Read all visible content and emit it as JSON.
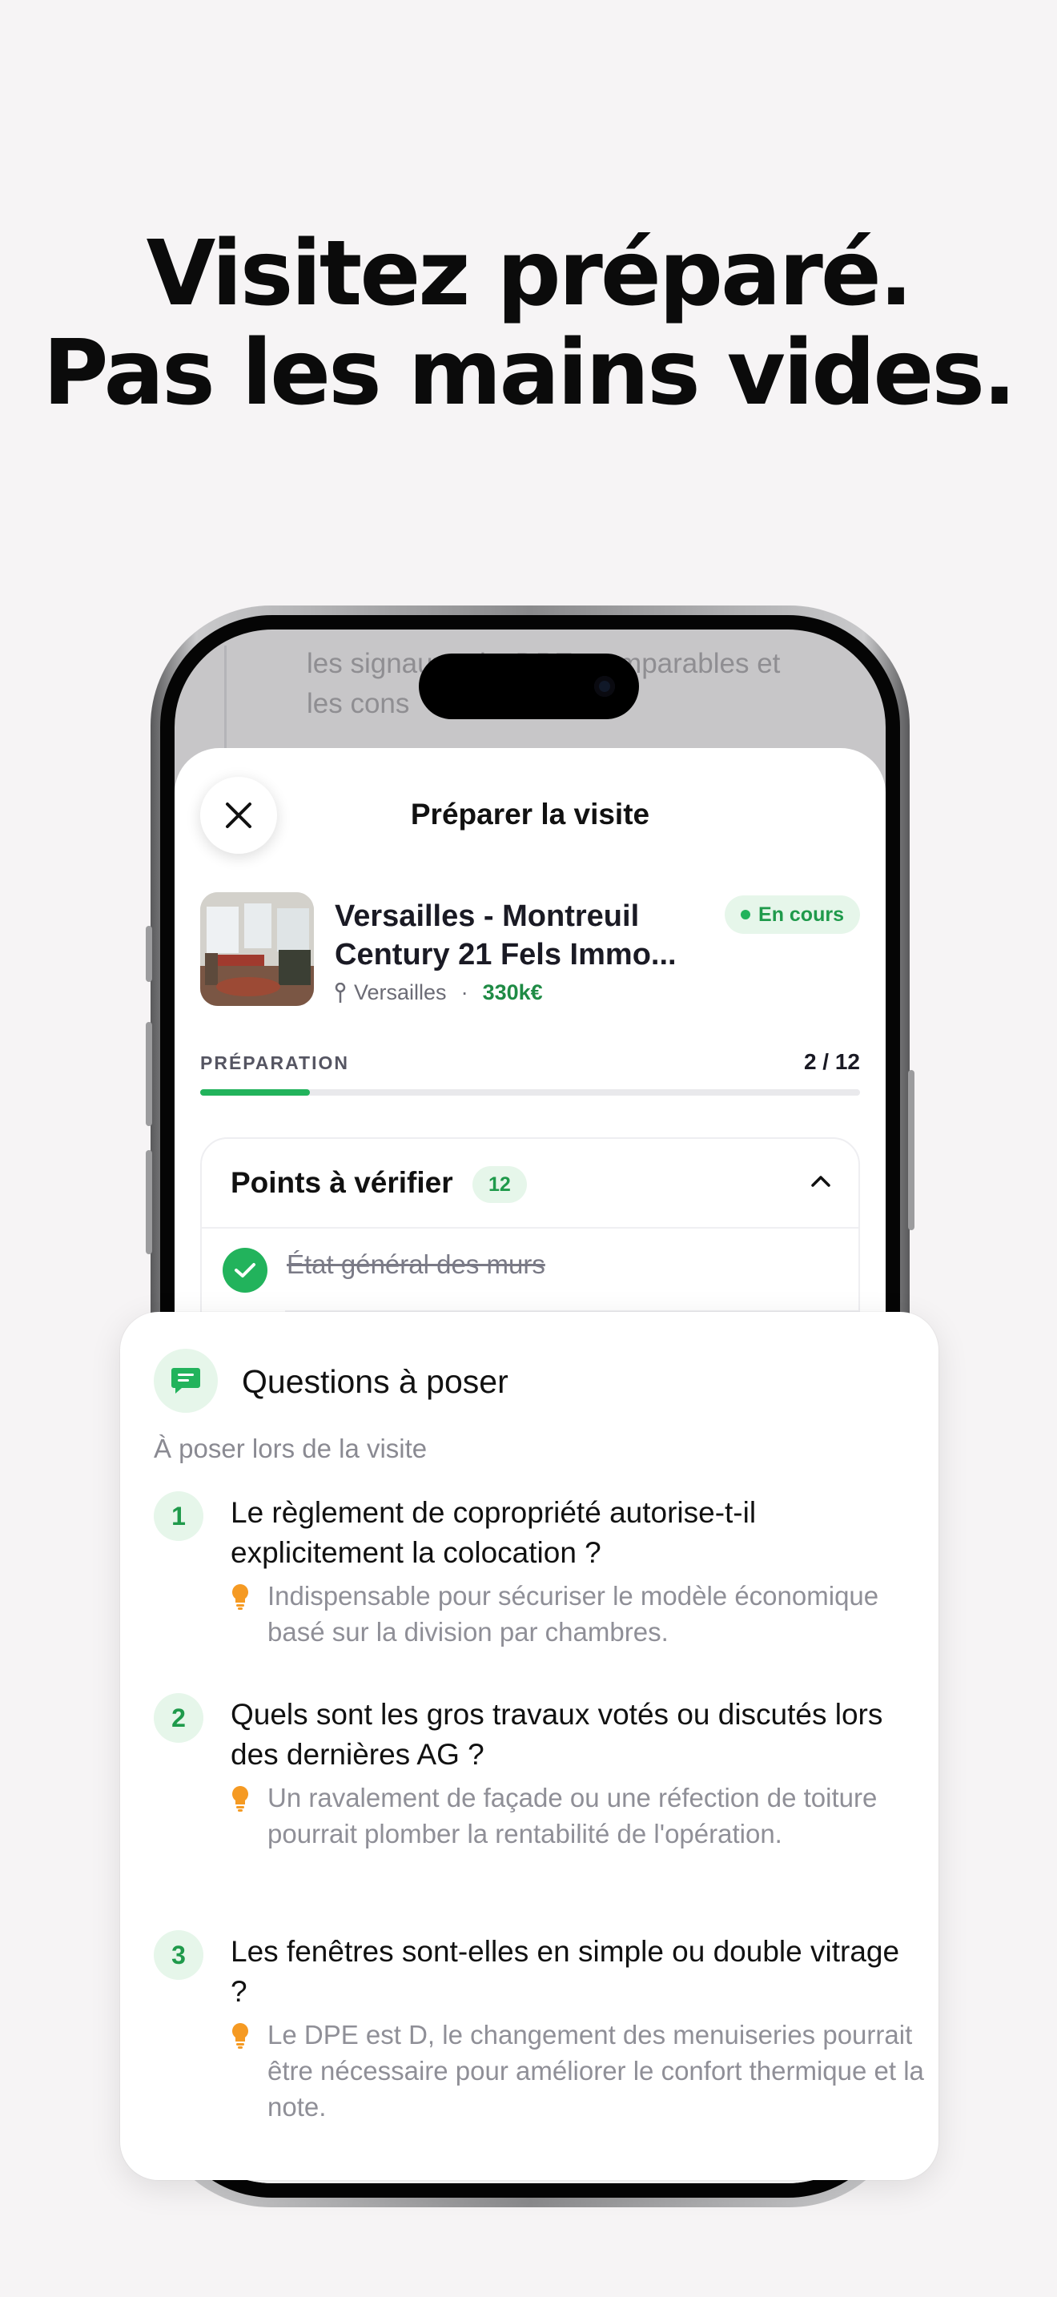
{
  "headline": {
    "line1": "Visitez préparé.",
    "line2": "Pas les mains vides."
  },
  "background_text": "les signaux prix, DPE, comparables et les cons",
  "sheet": {
    "title": "Préparer la visite",
    "close_icon": "close-icon"
  },
  "property": {
    "name_line1": "Versailles - Montreuil",
    "name_line2": "Century 21 Fels Immo...",
    "location": "Versailles",
    "separator": "·",
    "price": "330k€",
    "status": "En cours"
  },
  "preparation": {
    "label": "PRÉPARATION",
    "count": "2 / 12",
    "progress": 0.1667
  },
  "checklist": {
    "title": "Points à vérifier",
    "badge": "12",
    "items": [
      {
        "label": "État général des murs",
        "done": true
      }
    ]
  },
  "questions": {
    "title": "Questions à poser",
    "subtitle": "À poser lors de la visite",
    "items": [
      {
        "num": "1",
        "question": "Le règlement de copropriété autorise-t-il explicitement la colocation ?",
        "hint": "Indispensable pour sécuriser le modèle économique basé sur la division par chambres."
      },
      {
        "num": "2",
        "question": "Quels sont les gros travaux votés ou discutés lors des dernières AG ?",
        "hint": "Un ravalement de façade ou une réfection de toiture pourrait plomber la rentabilité de l'opération."
      },
      {
        "num": "3",
        "question": "Les fenêtres sont-elles en simple ou double vitrage ?",
        "hint": "Le DPE est D, le changement des menuiseries pourrait être nécessaire pour améliorer le confort thermique et la note."
      }
    ]
  },
  "colors": {
    "accent_green": "#22b35c",
    "badge_bg": "#e6f6ea",
    "hint_bulb": "#f59a23"
  }
}
